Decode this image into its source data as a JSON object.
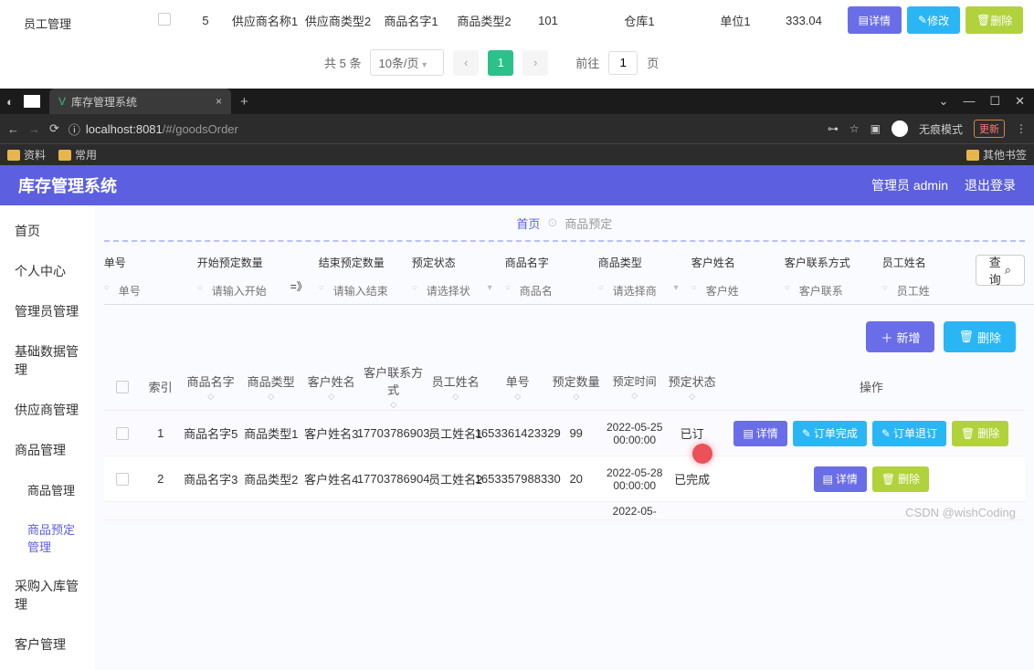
{
  "top_strip": {
    "sidebar_label": "员工管理",
    "row": {
      "idx": "5",
      "supplier_name": "供应商名称1",
      "supplier_type": "供应商类型2",
      "goods_name": "商品名字1",
      "goods_type": "商品类型2",
      "qty": "101",
      "warehouse": "仓库1",
      "unit": "单位1",
      "price": "333.04"
    },
    "btn_detail": "详情",
    "btn_edit": "修改",
    "btn_delete": "删除",
    "pagination": {
      "total": "共 5 条",
      "per_page": "10条/页",
      "current": "1",
      "goto_label": "前往",
      "goto_value": "1",
      "goto_suffix": "页"
    }
  },
  "browser": {
    "tab_title": "库存管理系统",
    "url_prefix": "localhost:8081",
    "url_path": "/#/goodsOrder",
    "incognito": "无痕模式",
    "update": "更新",
    "bm_data": "资料",
    "bm_common": "常用",
    "bm_other": "其他书签"
  },
  "app": {
    "title": "库存管理系统",
    "user_label": "管理员 admin",
    "logout": "退出登录"
  },
  "sidebar": {
    "items": [
      "首页",
      "个人中心",
      "管理员管理",
      "基础数据管理",
      "供应商管理",
      "商品管理",
      "采购入库管理",
      "客户管理"
    ],
    "subs": [
      "商品管理",
      "商品预定管理"
    ]
  },
  "crumb": {
    "home": "首页",
    "current": "商品预定"
  },
  "filters": {
    "order_no": {
      "label": "单号",
      "ph": "单号"
    },
    "start_qty": {
      "label": "开始预定数量",
      "ph": "请输入开始"
    },
    "arrow": "=》",
    "end_qty": {
      "label": "结束预定数量",
      "ph": "请输入结束"
    },
    "status": {
      "label": "预定状态",
      "ph": "请选择状"
    },
    "goods_name": {
      "label": "商品名字",
      "ph": "商品名"
    },
    "goods_type": {
      "label": "商品类型",
      "ph": "请选择商"
    },
    "cust_name": {
      "label": "客户姓名",
      "ph": "客户姓"
    },
    "cust_phone": {
      "label": "客户联系方式",
      "ph": "客户联系"
    },
    "emp_name": {
      "label": "员工姓名",
      "ph": "员工姓"
    },
    "search": "查询"
  },
  "actions": {
    "add": "新增",
    "delete": "删除"
  },
  "table": {
    "headers": {
      "idx": "索引",
      "name": "商品名字",
      "type": "商品类型",
      "cust": "客户姓名",
      "phone": "客户联系方式",
      "emp": "员工姓名",
      "order": "单号",
      "qty": "预定数量",
      "time": "预定时间",
      "status": "预定状态",
      "op": "操作"
    },
    "rows": [
      {
        "idx": "1",
        "name": "商品名字5",
        "type": "商品类型1",
        "cust": "客户姓名3",
        "phone": "17703786903",
        "emp": "员工姓名1",
        "order": "1653361423329",
        "qty": "99",
        "time": "2022-05-25 00:00:00",
        "status": "已订",
        "ops": [
          "详情",
          "订单完成",
          "订单退订",
          "删除"
        ]
      },
      {
        "idx": "2",
        "name": "商品名字3",
        "type": "商品类型2",
        "cust": "客户姓名4",
        "phone": "17703786904",
        "emp": "员工姓名2",
        "order": "1653357988330",
        "qty": "20",
        "time": "2022-05-28 00:00:00",
        "status": "已完成",
        "ops": [
          "详情",
          "删除"
        ]
      }
    ],
    "partial_time": "2022-05-"
  },
  "watermark": "CSDN @wishCoding"
}
